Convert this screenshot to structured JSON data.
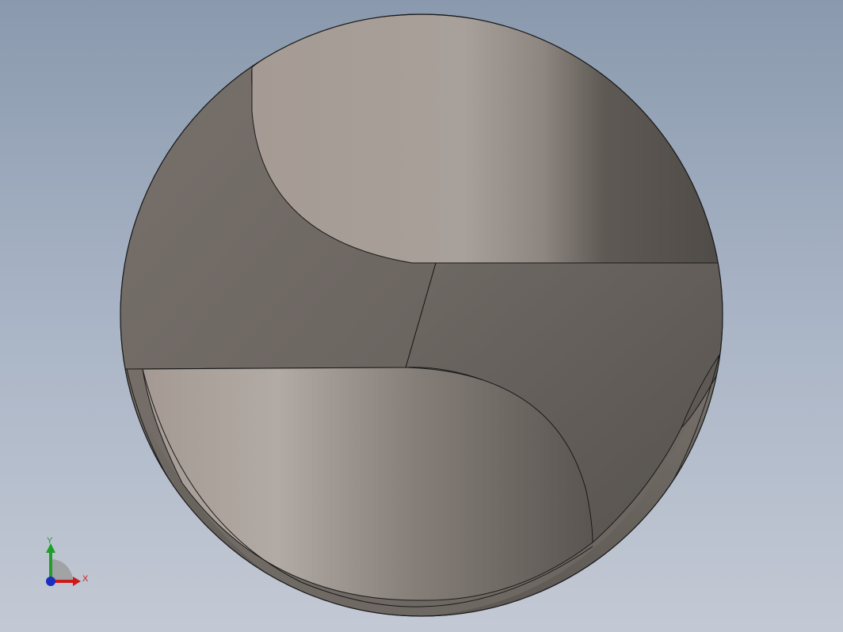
{
  "viewport": {
    "background_top": "#8a99ad",
    "background_bottom": "#c3c9d4",
    "model": "drill-tip-end-view"
  },
  "triad": {
    "x_label": "X",
    "y_label": "Y",
    "x_color": "#cc1a1a",
    "y_color": "#1f9e2a",
    "z_color": "#1a2ec2"
  }
}
